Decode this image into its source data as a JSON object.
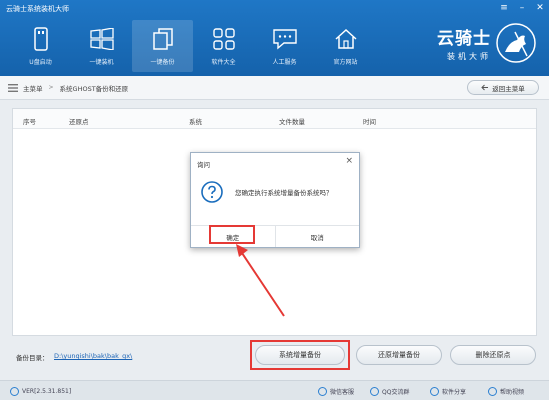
{
  "app": {
    "title": "云骑士系统装机大师"
  },
  "window_controls": [
    "≡",
    "–",
    "✕"
  ],
  "nav": [
    {
      "label": "U盘启动",
      "icon": "usb-drive-icon"
    },
    {
      "label": "一键装机",
      "icon": "windows-logo-icon"
    },
    {
      "label": "一键备份",
      "icon": "copy-backup-icon",
      "active": true
    },
    {
      "label": "软件大全",
      "icon": "apps-grid-icon"
    },
    {
      "label": "人工服务",
      "icon": "chat-service-icon"
    },
    {
      "label": "官方网站",
      "icon": "home-icon"
    }
  ],
  "brand": {
    "name": "云骑士",
    "sub": "装机大师"
  },
  "breadcrumb": {
    "home": "主菜单",
    "current": "系统GHOST备份和还原"
  },
  "back_button": "返回主菜单",
  "table": {
    "columns": [
      "序号",
      "还原点",
      "系统",
      "文件数量",
      "时间"
    ]
  },
  "dialog": {
    "title": "询问",
    "message": "您确定执行系统增量备份系统吗？",
    "ok": "确定",
    "cancel": "取消"
  },
  "bottom": {
    "backup_dir_label": "备份目录：",
    "backup_dir_path": "D:\\yunqishi\\bak\\bak_gx\\",
    "buttons": [
      "系统增量备份",
      "还原增量备份",
      "删除还原点"
    ]
  },
  "status": {
    "version": "VER[2.5.31.851]",
    "items": [
      "微信客服",
      "QQ交流群",
      "软件分享",
      "帮助视频"
    ]
  },
  "colors": {
    "accent": "#1a6dbd",
    "highlight": "#e53935",
    "link": "#1b63b5"
  }
}
